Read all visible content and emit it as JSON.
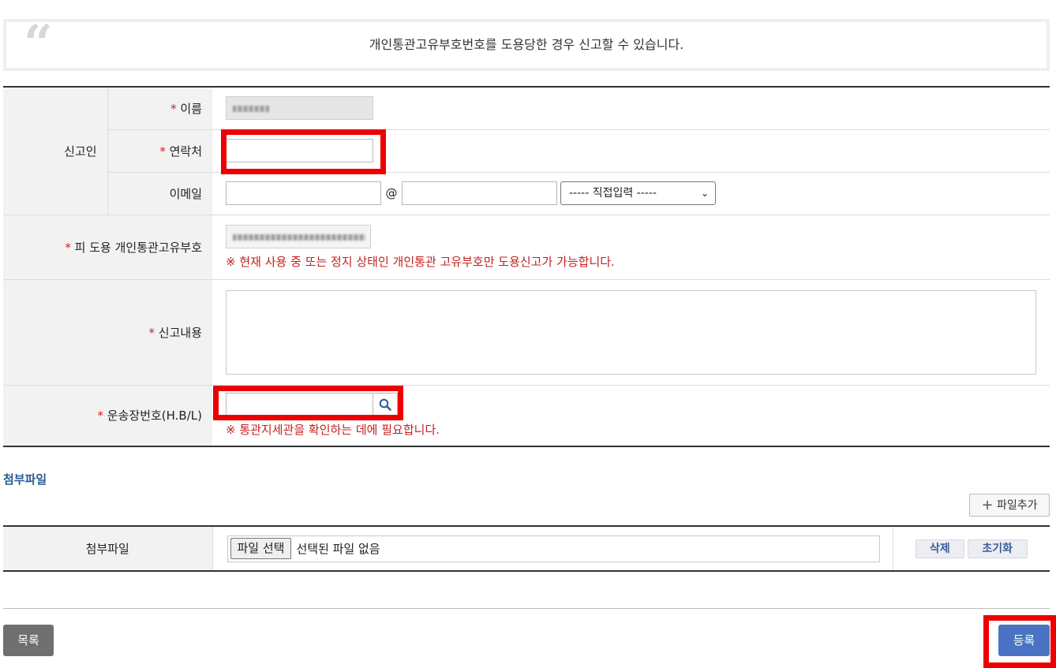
{
  "notice": {
    "text": "개인통관고유부호번호를 도용당한 경우 신고할 수 있습니다."
  },
  "form": {
    "reporter_group": "신고인",
    "required_mark": "*",
    "name_label": "이름",
    "contact_label": "연락처",
    "contact_value": "",
    "email_label": "이메일",
    "email_local_value": "",
    "email_at": "@",
    "email_domain_value": "",
    "email_domain_select": "----- 직접입력 -----",
    "stolen_code_label": "피 도용 개인통관고유부호",
    "stolen_code_warning": "※ 현재 사용 중 또는 정지 상태인 개인통관 고유부호만 도용신고가 가능합니다.",
    "content_label": "신고내용",
    "content_value": "",
    "waybill_label": "운송장번호(H.B/L)",
    "waybill_value": "",
    "waybill_warning": "※ 통관지세관을 확인하는 데에 필요합니다."
  },
  "attachments": {
    "section_title": "첨부파일",
    "add_button": "파일추가",
    "row_label": "첨부파일",
    "file_button": "파일 선택",
    "file_status": "선택된 파일 없음",
    "delete_button": "삭제",
    "reset_button": "초기화"
  },
  "footer": {
    "list_button": "목록",
    "register_button": "등록"
  },
  "icons": {
    "quote": "quote-icon",
    "search": "search-icon",
    "plus": "plus-icon",
    "chevron": "chevron-down-icon"
  },
  "colors": {
    "required": "#d21f1f",
    "warning": "#c42020",
    "section_title": "#2a5a95",
    "register_button": "#4a74c3",
    "list_button": "#6f6f6f",
    "highlight_box": "#ee0000"
  }
}
